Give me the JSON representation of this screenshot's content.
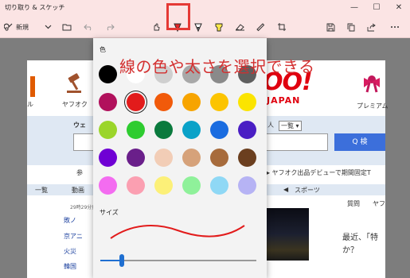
{
  "window": {
    "title": "切り取り & スケッチ",
    "minimize": "—",
    "maximize": "☐",
    "close": "✕"
  },
  "toolbar": {
    "new_label": "新規",
    "tools": [
      "touch-writing",
      "ballpoint-pen",
      "pencil",
      "highlighter",
      "eraser",
      "ruler",
      "crop"
    ],
    "right": [
      "save",
      "copy",
      "share",
      "more"
    ]
  },
  "picker": {
    "color_label": "色",
    "size_label": "サイズ",
    "size_fraction": 0.14,
    "selected_color": "#e21b1b",
    "colors": [
      "#000000",
      "#ffffff",
      "#cfcfcf",
      "#a8a8a8",
      "#8a8a8a",
      "#5f5f5f",
      "#b1115c",
      "#e21b1b",
      "#f15a0a",
      "#f7a400",
      "#fcc400",
      "#fbe400",
      "#9bd52a",
      "#2ecc30",
      "#0a7a3d",
      "#0aa2c8",
      "#1a6ce0",
      "#4a1ec4",
      "#6f00d4",
      "#6a1f8a",
      "#f2cdb6",
      "#d6a27a",
      "#a76b3c",
      "#6b3f1f",
      "#f36cf0",
      "#fb9fb1",
      "#fcf078",
      "#8ff19a",
      "#8fd8f5",
      "#b6b3f4"
    ]
  },
  "annotation": "線の色や太さを選択できる",
  "background_page": {
    "left_nav_label": "ル",
    "yafuoku_label": "ヤフオク",
    "premium_label": "プレミアム",
    "yahoo_logo": "OO!",
    "japan_label": "JAPAN",
    "web_label": "ウェ",
    "person_label": "人",
    "list_label": "一覧 ▾",
    "search_button": "Q 検",
    "tip_left": "参",
    "tip_right": "▸ ヤフオク出品デビューで期間固定T",
    "tab_ichiran": "一覧",
    "tab_douga": "動画",
    "tab_sports": "スポーツ",
    "tab_arrow": "◀",
    "news_time": "29時29分更新",
    "news_items": [
      "敗ノ",
      "京アニ",
      "火災",
      "韓国"
    ],
    "question_tab": "質問",
    "yafu_tab": "ヤフ",
    "question_text_1": "最近、「特",
    "question_text_2": "か？"
  }
}
